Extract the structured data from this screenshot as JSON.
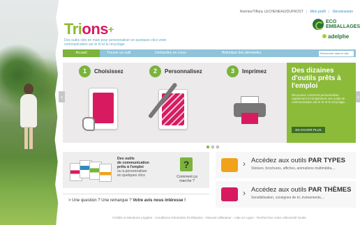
{
  "header": {
    "logo_part1": "Tri",
    "logo_part2": "ons",
    "logo_plus": "+",
    "tagline": "Des outils clés en main pour personnaliser en quelques clics votre communication sur le tri et le recyclage",
    "user_name": "Noémie/Tiffany LECHENEAU/DUFROST",
    "profile_link": "Mon profil",
    "logout_link": "Déconnexion",
    "partner1": "ECO EMBALLAGES",
    "partner2": "adelphe"
  },
  "nav": {
    "items": [
      "Accueil",
      "Trouver un outil",
      "Demandes en cours",
      "Historique des demandes"
    ],
    "search_placeholder": "Recherche dans le site"
  },
  "hero": {
    "steps": [
      {
        "num": "1",
        "label": "Choisissez"
      },
      {
        "num": "2",
        "label": "Personnalisez"
      },
      {
        "num": "3",
        "label": "Imprimez"
      }
    ],
    "promo_title": "Des dizaines d'outils prêts à l'emploi",
    "promo_text": "Découvrez comment personnaliser rapidement et simplement vos outils de communication sur le tri et le recyclage.",
    "promo_button": "EN SAVOIR PLUS",
    "prev_arrow": "‹",
    "next_arrow": "›"
  },
  "tools_box": {
    "line1": "Des outils",
    "line2": "de communication",
    "line3": "prêts à l'emploi",
    "line4": "ou à personnaliser",
    "line5": "en quelques clics",
    "question_mark": "?",
    "help_label": "Comment ça marche ?"
  },
  "question_row": {
    "prefix": "> Une question ? Une remarque ? ",
    "strong": "Votre avis nous intéresse !"
  },
  "access": [
    {
      "title_plain": "Accédez aux outils ",
      "title_bold": "PAR TYPES",
      "subtitle": "Stickers, brochures, affiches, animations multimédia,..."
    },
    {
      "title_plain": "Accédez aux outils ",
      "title_bold": "PAR THÈMES",
      "subtitle": "Sensibilisation, consignes de tri, événements,..."
    }
  ],
  "footer": {
    "text": "Crédits et Mentions Légales - Conditions Générales d'Utilisation - Manuel Utilisateur - Aide en Ligne - Rechercher votre collectivité locale"
  },
  "colors": {
    "accent_green": "#7bb33b",
    "accent_pink": "#d81b60",
    "nav_blue": "#8fc3d9"
  }
}
